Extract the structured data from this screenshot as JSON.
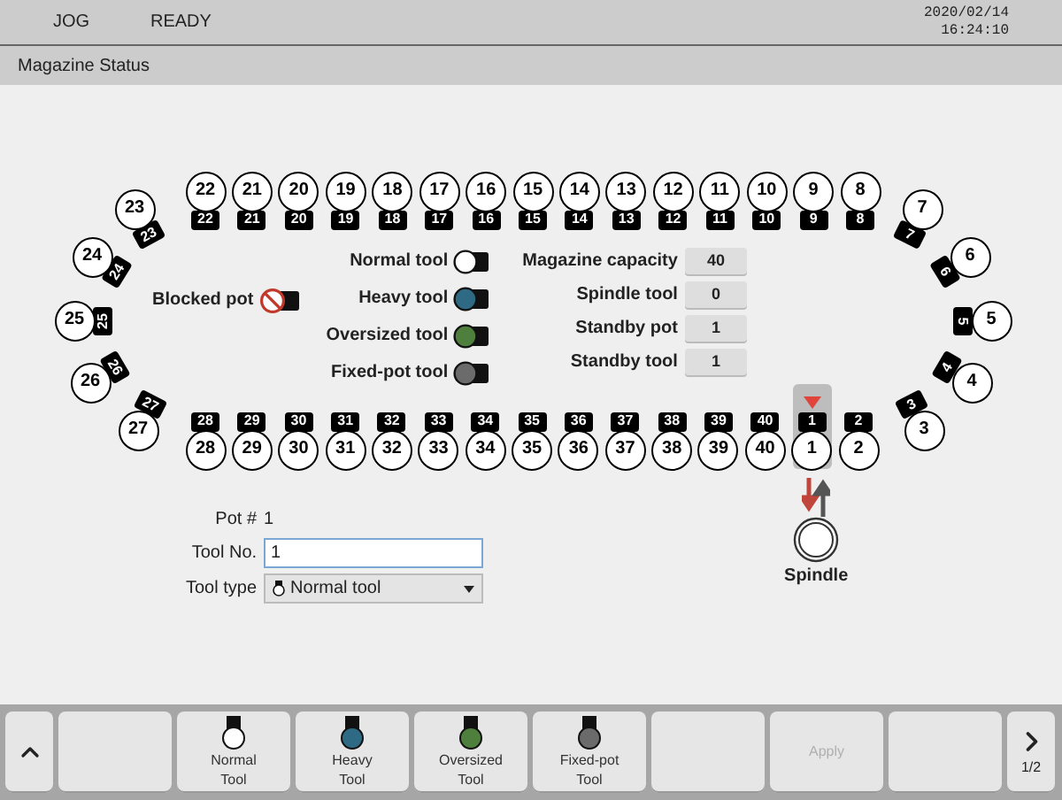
{
  "status_bar": {
    "mode": "JOG",
    "state": "READY",
    "date": "2020/02/14",
    "time": "16:24:10"
  },
  "screen_title": "Magazine Status",
  "pots": [
    {
      "pot": "22",
      "tool": "22",
      "selected": false
    },
    {
      "pot": "21",
      "tool": "21",
      "selected": false
    },
    {
      "pot": "20",
      "tool": "20",
      "selected": false
    },
    {
      "pot": "19",
      "tool": "19",
      "selected": false
    },
    {
      "pot": "18",
      "tool": "18",
      "selected": false
    },
    {
      "pot": "17",
      "tool": "17",
      "selected": false
    },
    {
      "pot": "16",
      "tool": "16",
      "selected": false
    },
    {
      "pot": "15",
      "tool": "15",
      "selected": false
    },
    {
      "pot": "14",
      "tool": "14",
      "selected": false
    },
    {
      "pot": "13",
      "tool": "13",
      "selected": false
    },
    {
      "pot": "12",
      "tool": "12",
      "selected": false
    },
    {
      "pot": "11",
      "tool": "11",
      "selected": false
    },
    {
      "pot": "10",
      "tool": "10",
      "selected": false
    },
    {
      "pot": "9",
      "tool": "9",
      "selected": false
    },
    {
      "pot": "8",
      "tool": "8",
      "selected": false
    },
    {
      "pot": "23",
      "tool": "23",
      "selected": false
    },
    {
      "pot": "7",
      "tool": "7",
      "selected": false
    },
    {
      "pot": "24",
      "tool": "24",
      "selected": false
    },
    {
      "pot": "6",
      "tool": "6",
      "selected": false
    },
    {
      "pot": "25",
      "tool": "25",
      "selected": false
    },
    {
      "pot": "5",
      "tool": "5",
      "selected": false
    },
    {
      "pot": "26",
      "tool": "26",
      "selected": false
    },
    {
      "pot": "4",
      "tool": "4",
      "selected": false
    },
    {
      "pot": "27",
      "tool": "27",
      "selected": false
    },
    {
      "pot": "3",
      "tool": "3",
      "selected": false
    },
    {
      "pot": "28",
      "tool": "28",
      "selected": false
    },
    {
      "pot": "29",
      "tool": "29",
      "selected": false
    },
    {
      "pot": "30",
      "tool": "30",
      "selected": false
    },
    {
      "pot": "31",
      "tool": "31",
      "selected": false
    },
    {
      "pot": "32",
      "tool": "32",
      "selected": false
    },
    {
      "pot": "33",
      "tool": "33",
      "selected": false
    },
    {
      "pot": "34",
      "tool": "34",
      "selected": false
    },
    {
      "pot": "35",
      "tool": "35",
      "selected": false
    },
    {
      "pot": "36",
      "tool": "36",
      "selected": false
    },
    {
      "pot": "37",
      "tool": "37",
      "selected": false
    },
    {
      "pot": "38",
      "tool": "38",
      "selected": false
    },
    {
      "pot": "39",
      "tool": "39",
      "selected": false
    },
    {
      "pot": "40",
      "tool": "40",
      "selected": false
    },
    {
      "pot": "1",
      "tool": "1",
      "selected": true
    },
    {
      "pot": "2",
      "tool": "2",
      "selected": false
    }
  ],
  "blocked_pot": {
    "label": "Blocked pot"
  },
  "legend": [
    {
      "label": "Normal tool",
      "color": "#ffffff"
    },
    {
      "label": "Heavy tool",
      "color": "#2e6a84"
    },
    {
      "label": "Oversized tool",
      "color": "#4e7f3d"
    },
    {
      "label": "Fixed-pot tool",
      "color": "#6b6b6b"
    }
  ],
  "info": [
    {
      "label": "Magazine capacity",
      "value": "40"
    },
    {
      "label": "Spindle tool",
      "value": "0"
    },
    {
      "label": "Standby pot",
      "value": "1"
    },
    {
      "label": "Standby tool",
      "value": "1"
    }
  ],
  "spindle": {
    "label": "Spindle"
  },
  "form": {
    "pot_label": "Pot #",
    "pot_value": "1",
    "tool_no_label": "Tool No.",
    "tool_no_value": "1",
    "tool_type_label": "Tool type",
    "tool_type_value": "Normal tool"
  },
  "softkeys": [
    {
      "kind": "up"
    },
    {
      "kind": "blank"
    },
    {
      "kind": "tool",
      "label": "Normal\nTool",
      "color": "#ffffff"
    },
    {
      "kind": "tool",
      "label": "Heavy\nTool",
      "color": "#2e6a84"
    },
    {
      "kind": "tool",
      "label": "Oversized\nTool",
      "color": "#4e7f3d"
    },
    {
      "kind": "tool",
      "label": "Fixed-pot\nTool",
      "color": "#6b6b6b"
    },
    {
      "kind": "blank"
    },
    {
      "kind": "text",
      "label": "Apply",
      "disabled": true
    },
    {
      "kind": "blank"
    },
    {
      "kind": "next",
      "page": "1/2"
    }
  ]
}
